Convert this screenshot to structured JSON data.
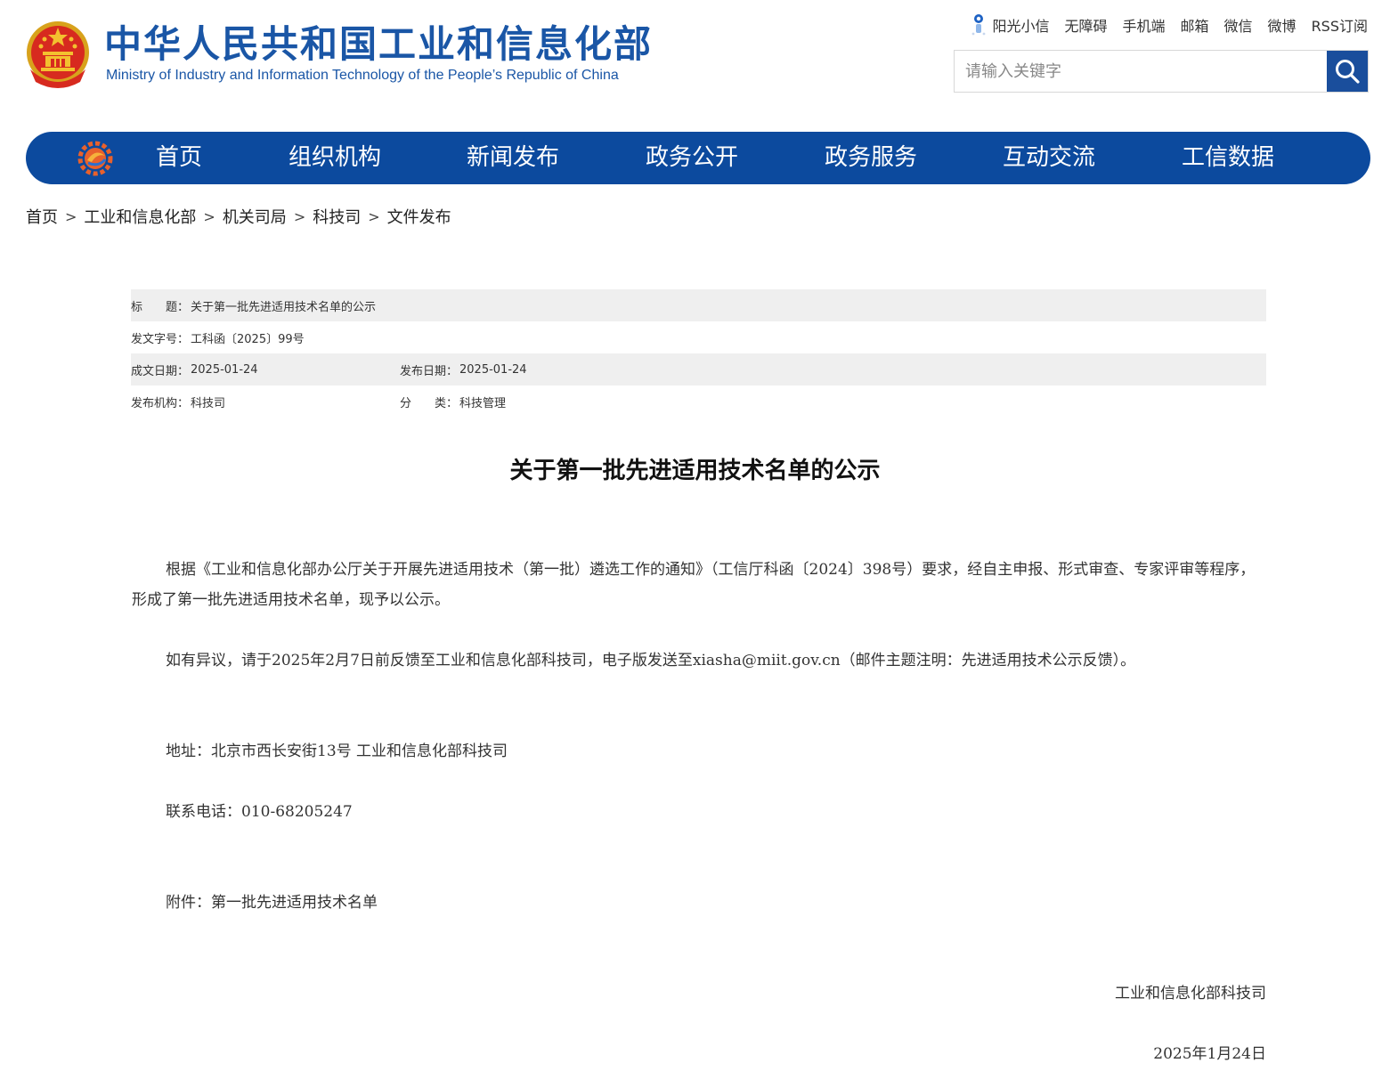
{
  "header": {
    "title": "中华人民共和国工业和信息化部",
    "subtitle": "Ministry of Industry and Information Technology of the People’s Republic of China",
    "links": [
      "阳光小信",
      "无障碍",
      "手机端",
      "邮箱",
      "微信",
      "微博",
      "RSS订阅"
    ],
    "search_placeholder": "请输入关键字",
    "colors": {
      "brand_blue": "#1a56a6",
      "nav_blue": "#0c4a9e"
    }
  },
  "nav": {
    "items": [
      "首页",
      "组织机构",
      "新闻发布",
      "政务公开",
      "政务服务",
      "互动交流",
      "工信数据"
    ]
  },
  "breadcrumb": {
    "items": [
      "首页",
      "工业和信息化部",
      "机关司局",
      "科技司",
      "文件发布"
    ],
    "separator": ">"
  },
  "meta": {
    "title_key": "标　　题：",
    "title_val": "关于第一批先进适用技术名单的公示",
    "docno_key": "发文字号：",
    "docno_val": "工科函〔2025〕99号",
    "written_key": "成文日期：",
    "written_val": "2025-01-24",
    "published_key": "发布日期：",
    "published_val": "2025-01-24",
    "org_key": "发布机构：",
    "org_val": "科技司",
    "category_key": "分　　类：",
    "category_val": "科技管理"
  },
  "article": {
    "title": "关于第一批先进适用技术名单的公示",
    "p1": "根据《工业和信息化部办公厅关于开展先进适用技术（第一批）遴选工作的通知》（工信厅科函〔2024〕398号）要求，经自主申报、形式审查、专家评审等程序，形成了第一批先进适用技术名单，现予以公示。",
    "p2": "如有异议，请于2025年2月7日前反馈至工业和信息化部科技司，电子版发送至xiasha@miit.gov.cn（邮件主题注明：先进适用技术公示反馈）。",
    "address": "地址：北京市西长安街13号 工业和信息化部科技司",
    "phone": "联系电话：010-68205247",
    "attachment": "附件：第一批先进适用技术名单",
    "signature": "工业和信息化部科技司",
    "date": "2025年1月24日"
  }
}
